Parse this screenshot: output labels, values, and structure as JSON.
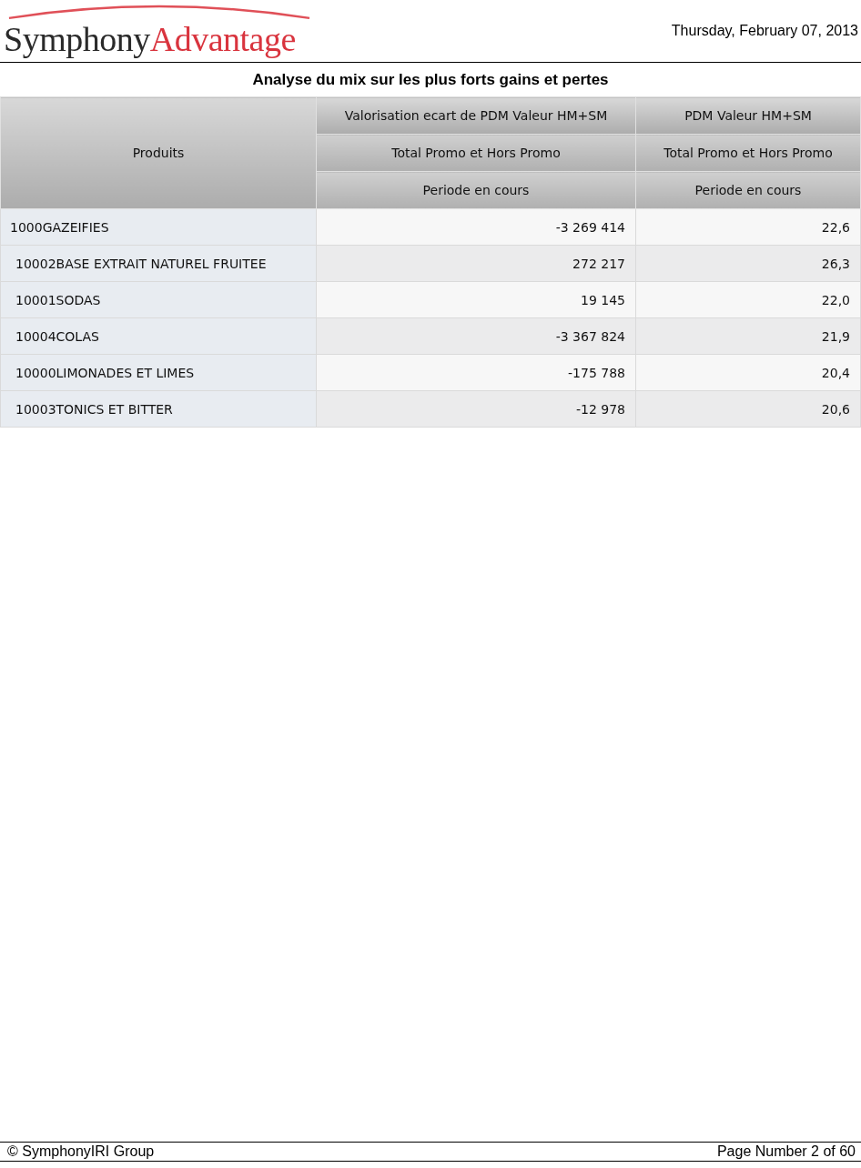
{
  "header": {
    "logo": {
      "part_1": "Symphony",
      "part_2": "Advantage"
    },
    "date": "Thursday, February 07, 2013"
  },
  "report_title": "Analyse du mix sur les plus forts gains et pertes",
  "table": {
    "row_header": "Produits",
    "columns": [
      {
        "measure": "Valorisation ecart de PDM Valeur HM+SM",
        "promo": "Total Promo et Hors Promo",
        "period": "Periode en cours"
      },
      {
        "measure": "PDM Valeur HM+SM",
        "promo": "Total Promo et Hors Promo",
        "period": "Periode en cours"
      }
    ],
    "rows": [
      {
        "product": "1000GAZEIFIES",
        "values": [
          "-3 269 414",
          "22,6"
        ],
        "children": [
          {
            "product": "10002BASE EXTRAIT NATUREL FRUITEE",
            "values": [
              "272 217",
              "26,3"
            ]
          },
          {
            "product": "10001SODAS",
            "values": [
              "19 145",
              "22,0"
            ]
          },
          {
            "product": "10004COLAS",
            "values": [
              "-3 367 824",
              "21,9"
            ]
          },
          {
            "product": "10000LIMONADES ET LIMES",
            "values": [
              "-175 788",
              "20,4"
            ]
          },
          {
            "product": "10003TONICS ET BITTER",
            "values": [
              "-12 978",
              "20,6"
            ]
          }
        ]
      }
    ]
  },
  "footer": {
    "copyright": "© SymphonyIRI Group",
    "page": "Page Number 2 of 60"
  }
}
